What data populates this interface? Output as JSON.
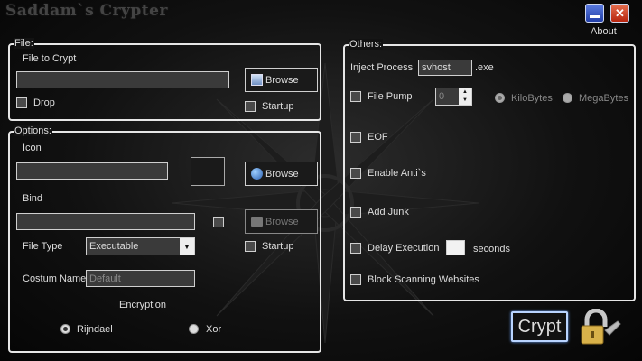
{
  "window": {
    "title": "Saddam`s Crypter",
    "about": "About"
  },
  "file_group": {
    "legend": "File:",
    "file_label": "File to Crypt",
    "file_value": "",
    "browse": "Browse",
    "drop": "Drop",
    "startup": "Startup"
  },
  "options_group": {
    "legend": "Options:",
    "icon_label": "Icon",
    "icon_value": "",
    "browse": "Browse",
    "bind_label": "Bind",
    "bind_value": "",
    "bind_browse": "Browse",
    "file_type_label": "File Type",
    "file_type_value": "Executable",
    "startup": "Startup",
    "custom_name_label": "Costum Name",
    "custom_name_value": "Default",
    "encryption_label": "Encryption",
    "encryption_options": [
      "Rijndael",
      "Xor"
    ],
    "encryption_selected": "Rijndael"
  },
  "others_group": {
    "legend": "Others:",
    "inject_label": "Inject Process",
    "inject_value": "svhost",
    "inject_suffix": ".exe",
    "file_pump": "File Pump",
    "pump_value": "0",
    "unit_kb": "KiloBytes",
    "unit_mb": "MegaBytes",
    "eof": "EOF",
    "anti": "Enable Anti`s",
    "junk": "Add Junk",
    "delay": "Delay Execution",
    "delay_value": "",
    "seconds": "seconds",
    "block": "Block Scanning Websites"
  },
  "crypt_button": "Crypt"
}
